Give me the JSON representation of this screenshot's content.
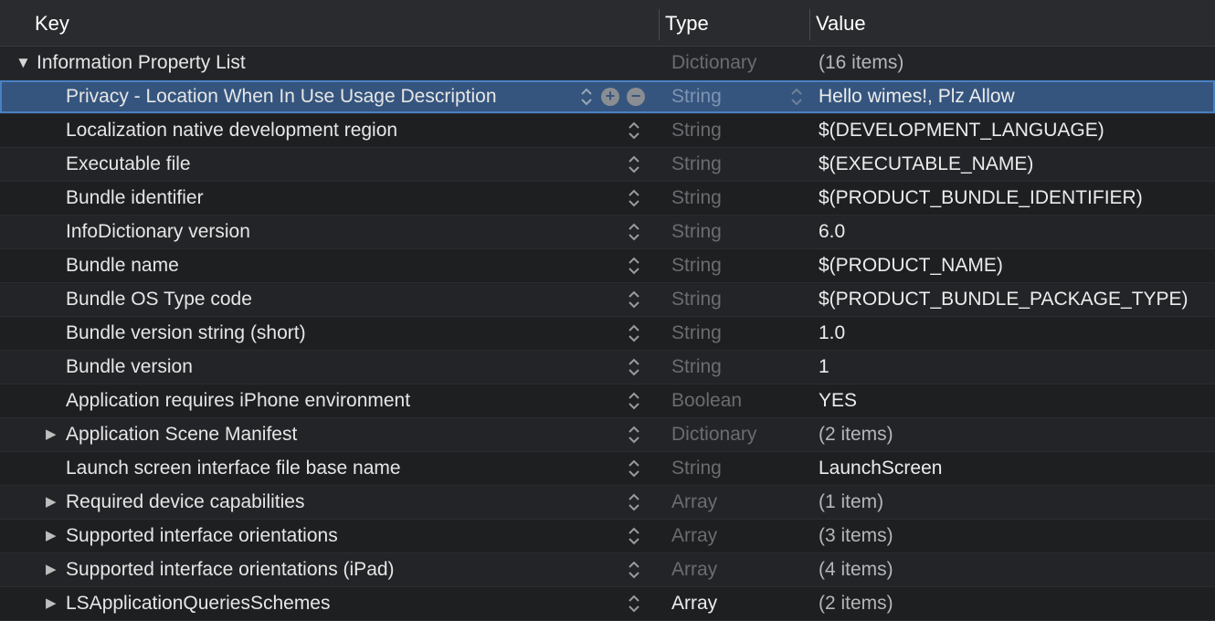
{
  "header": {
    "key": "Key",
    "type": "Type",
    "value": "Value"
  },
  "root": {
    "key": "Information Property List",
    "type": "Dictionary",
    "value": "(16 items)"
  },
  "rows": [
    {
      "key": "Privacy - Location When In Use Usage Description",
      "type": "String",
      "value": "Hello wimes!, Plz Allow"
    },
    {
      "key": "Localization native development region",
      "type": "String",
      "value": "$(DEVELOPMENT_LANGUAGE)"
    },
    {
      "key": "Executable file",
      "type": "String",
      "value": "$(EXECUTABLE_NAME)"
    },
    {
      "key": "Bundle identifier",
      "type": "String",
      "value": "$(PRODUCT_BUNDLE_IDENTIFIER)"
    },
    {
      "key": "InfoDictionary version",
      "type": "String",
      "value": "6.0"
    },
    {
      "key": "Bundle name",
      "type": "String",
      "value": "$(PRODUCT_NAME)"
    },
    {
      "key": "Bundle OS Type code",
      "type": "String",
      "value": "$(PRODUCT_BUNDLE_PACKAGE_TYPE)"
    },
    {
      "key": "Bundle version string (short)",
      "type": "String",
      "value": "1.0"
    },
    {
      "key": "Bundle version",
      "type": "String",
      "value": "1"
    },
    {
      "key": "Application requires iPhone environment",
      "type": "Boolean",
      "value": "YES"
    },
    {
      "key": "Application Scene Manifest",
      "type": "Dictionary",
      "value": "(2 items)"
    },
    {
      "key": "Launch screen interface file base name",
      "type": "String",
      "value": "LaunchScreen"
    },
    {
      "key": "Required device capabilities",
      "type": "Array",
      "value": "(1 item)"
    },
    {
      "key": "Supported interface orientations",
      "type": "Array",
      "value": "(3 items)"
    },
    {
      "key": "Supported interface orientations (iPad)",
      "type": "Array",
      "value": "(4 items)"
    },
    {
      "key": "LSApplicationQueriesSchemes",
      "type": "Array",
      "value": "(2 items)"
    }
  ],
  "icons": {
    "add": "+",
    "remove": "−",
    "collapsed": "▶",
    "expanded": "▼"
  },
  "colors": {
    "selection": "#35557e",
    "background": "#1e1f21",
    "header": "#2a2b2e"
  }
}
